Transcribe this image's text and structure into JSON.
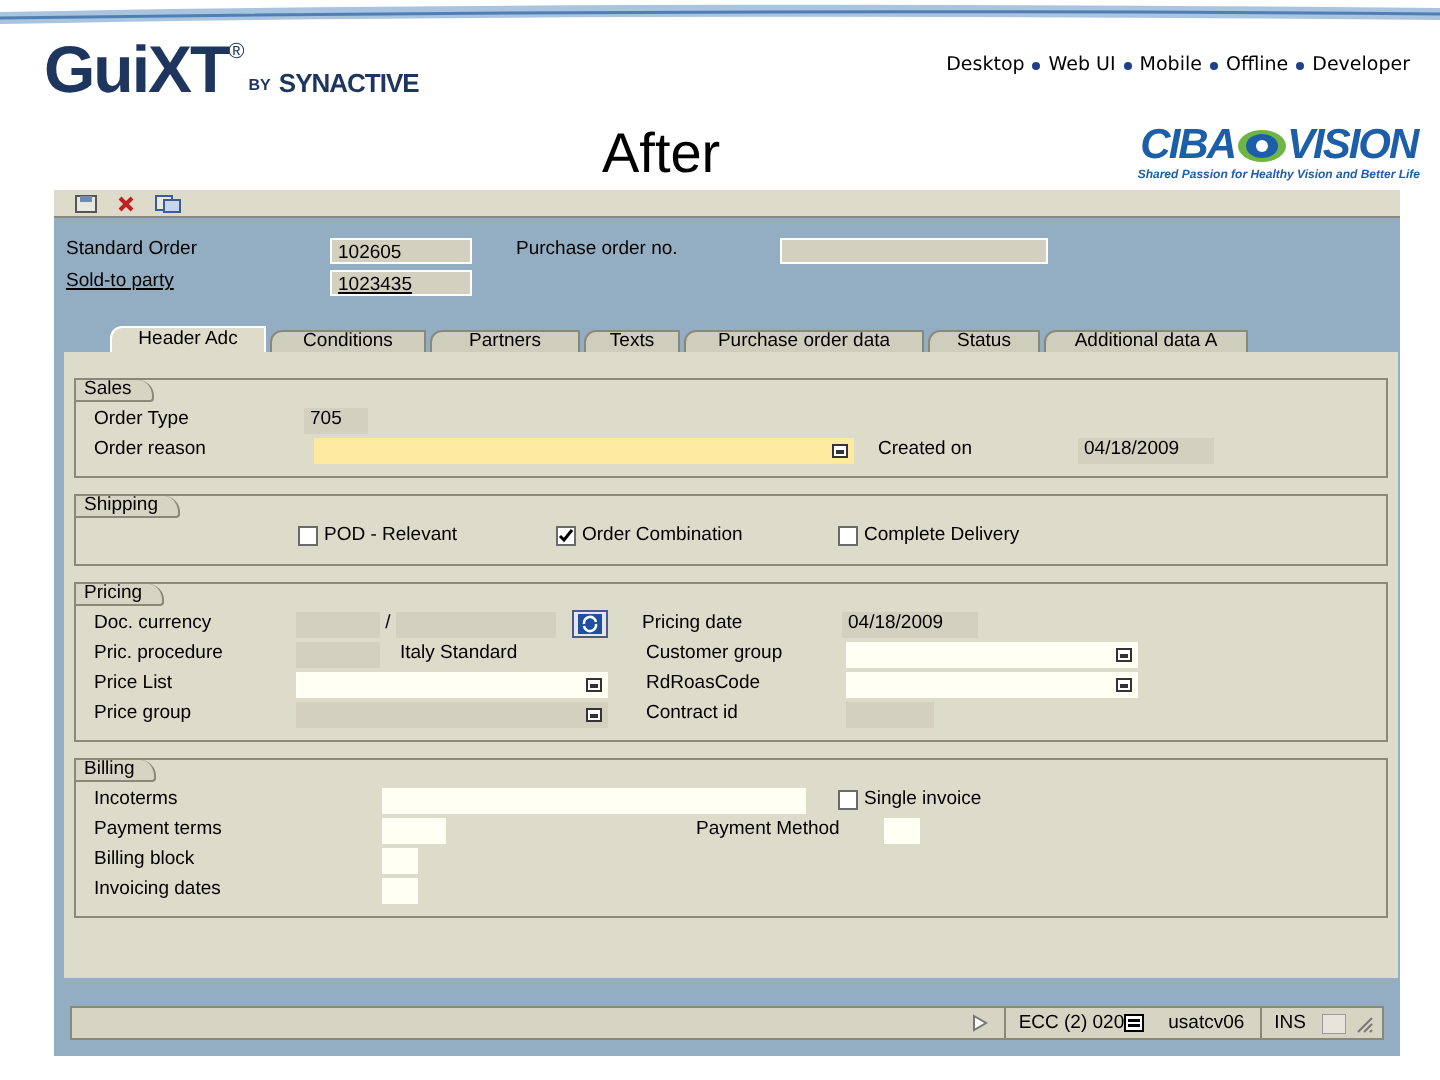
{
  "slide": {
    "brand": {
      "name": "GuiXT",
      "mark": "®",
      "by": "BY",
      "company": "SYNACTIVE"
    },
    "nav": [
      "Desktop",
      "Web UI",
      "Mobile",
      "Offline",
      "Developer"
    ],
    "title": "After",
    "partner": {
      "left": "CIBA",
      "right": "VISION",
      "tagline": "Shared Passion for Healthy Vision and Better Life"
    }
  },
  "header": {
    "fields": [
      {
        "label": "Standard Order",
        "value": "102605"
      },
      {
        "label": "Sold-to party",
        "value": "1023435",
        "link": true
      },
      {
        "label": "Purchase order no."
      }
    ]
  },
  "tabs": [
    {
      "label": "Header Adc",
      "selected": true
    },
    {
      "label": "Conditions",
      "selected": false
    },
    {
      "label": "Partners",
      "selected": false
    },
    {
      "label": "Texts",
      "selected": false
    },
    {
      "label": "Purchase order data",
      "selected": false
    },
    {
      "label": "Status",
      "selected": false
    },
    {
      "label": "Additional data A",
      "selected": false
    }
  ],
  "sections": [
    {
      "title": "Sales",
      "rows": [
        [
          {
            "kind": "label",
            "text": "Order Type"
          },
          {
            "kind": "display_field",
            "value": "705"
          }
        ],
        [
          {
            "kind": "label",
            "text": "Order reason"
          },
          {
            "kind": "required_field",
            "dropdown": true
          },
          {
            "kind": "label",
            "text": "Created on"
          },
          {
            "kind": "display_field",
            "value": "04/18/2009"
          }
        ]
      ]
    },
    {
      "title": "Shipping",
      "rows": [
        [
          {
            "kind": "checkbox",
            "text": "POD - Relevant",
            "checked": false
          },
          {
            "kind": "checkbox",
            "text": "Order Combination",
            "checked": true
          },
          {
            "kind": "checkbox",
            "text": "Complete Delivery",
            "checked": false
          }
        ]
      ]
    },
    {
      "title": "Pricing",
      "rows": [
        [
          {
            "kind": "label",
            "text": "Doc. currency"
          },
          {
            "kind": "display_field"
          },
          {
            "kind": "text",
            "text": "/"
          },
          {
            "kind": "display_field"
          },
          {
            "kind": "button"
          },
          {
            "kind": "label",
            "text": "Pricing date"
          },
          {
            "kind": "display_field",
            "value": "04/18/2009"
          }
        ],
        [
          {
            "kind": "label",
            "text": "Pric. procedure"
          },
          {
            "kind": "display_field"
          },
          {
            "kind": "text",
            "text": "Italy Standard"
          },
          {
            "kind": "label",
            "text": "Customer group"
          },
          {
            "kind": "input_field",
            "dropdown": true
          }
        ],
        [
          {
            "kind": "label",
            "text": "Price List"
          },
          {
            "kind": "input_field",
            "dropdown": true
          },
          {
            "kind": "label",
            "text": "RdRoasCode"
          },
          {
            "kind": "input_field",
            "dropdown": true
          }
        ],
        [
          {
            "kind": "label",
            "text": "Price group"
          },
          {
            "kind": "display_field",
            "dropdown": true
          },
          {
            "kind": "label",
            "text": "Contract id"
          },
          {
            "kind": "display_field"
          }
        ]
      ]
    },
    {
      "title": "Billing",
      "rows": [
        [
          {
            "kind": "label",
            "text": "Incoterms"
          },
          {
            "kind": "input_field"
          },
          {
            "kind": "checkbox",
            "text": "Single invoice",
            "checked": false
          }
        ],
        [
          {
            "kind": "label",
            "text": "Payment terms"
          },
          {
            "kind": "input_field"
          },
          {
            "kind": "label",
            "text": "Payment Method"
          },
          {
            "kind": "input_field"
          }
        ],
        [
          {
            "kind": "label",
            "text": "Billing block"
          },
          {
            "kind": "input_field"
          }
        ],
        [
          {
            "kind": "label",
            "text": "Invoicing dates"
          },
          {
            "kind": "input_field"
          }
        ]
      ]
    }
  ],
  "status_bar": {
    "system": "ECC (2) 020",
    "user": "usatcv06",
    "mode": "INS"
  }
}
